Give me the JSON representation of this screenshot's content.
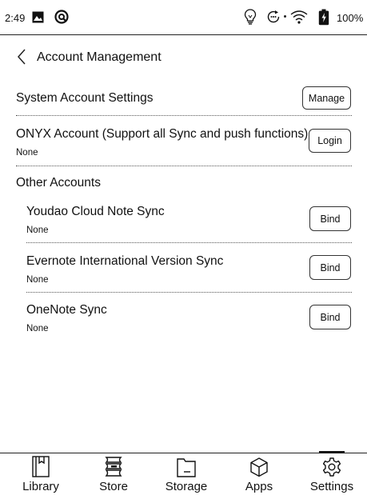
{
  "status_bar": {
    "time": "2:49",
    "battery_percent": "100%",
    "icons": [
      "gallery-icon",
      "sync-status-icon",
      "bulb-icon",
      "refresh-icon",
      "wifi-icon",
      "battery-icon"
    ]
  },
  "header": {
    "back_icon": "chevron-left-icon",
    "title": "Account Management"
  },
  "system_account": {
    "label": "System Account Settings",
    "button": "Manage"
  },
  "onyx_account": {
    "label": "ONYX Account (Support all Sync and push functions)",
    "status": "None",
    "button": "Login"
  },
  "other_accounts": {
    "heading": "Other Accounts",
    "items": [
      {
        "label": "Youdao Cloud Note Sync",
        "status": "None",
        "button": "Bind"
      },
      {
        "label": "Evernote International Version Sync",
        "status": "None",
        "button": "Bind"
      },
      {
        "label": "OneNote Sync",
        "status": "None",
        "button": "Bind"
      }
    ]
  },
  "nav": {
    "active": "Settings",
    "items": [
      {
        "label": "Library",
        "icon": "book-icon"
      },
      {
        "label": "Store",
        "icon": "store-icon"
      },
      {
        "label": "Storage",
        "icon": "folder-icon"
      },
      {
        "label": "Apps",
        "icon": "cube-icon"
      },
      {
        "label": "Settings",
        "icon": "gear-icon"
      }
    ]
  }
}
